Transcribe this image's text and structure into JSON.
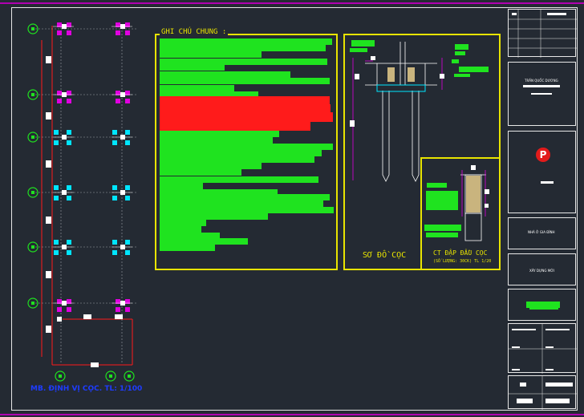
{
  "notes": {
    "title": "GHI CHÚ CHUNG :"
  },
  "pile_diagram": {
    "title": "SƠ ĐỒ CỌC"
  },
  "pile_cap": {
    "title": "CT ĐẬP ĐẦU CỌC",
    "subtitle": "(SỐ LƯỢNG: 30CK) TL 1/20"
  },
  "plan": {
    "caption": "MB. ĐỊNH VỊ CỌC. TL: 1/100"
  },
  "title_block": {
    "owner": "TRẦN QUỐC DƯƠNG",
    "logo_letter": "P",
    "project": "NHÀ Ở GIA ĐÌNH",
    "item": "XÂY DỰNG MỚI"
  },
  "colors": {
    "background": "#242a33",
    "green": "#1fe31f",
    "red": "#ff1b1b",
    "yellow": "#e8e400",
    "magenta": "#e000e0",
    "cyan": "#00e5ff",
    "frame": "#e8e8e8"
  }
}
